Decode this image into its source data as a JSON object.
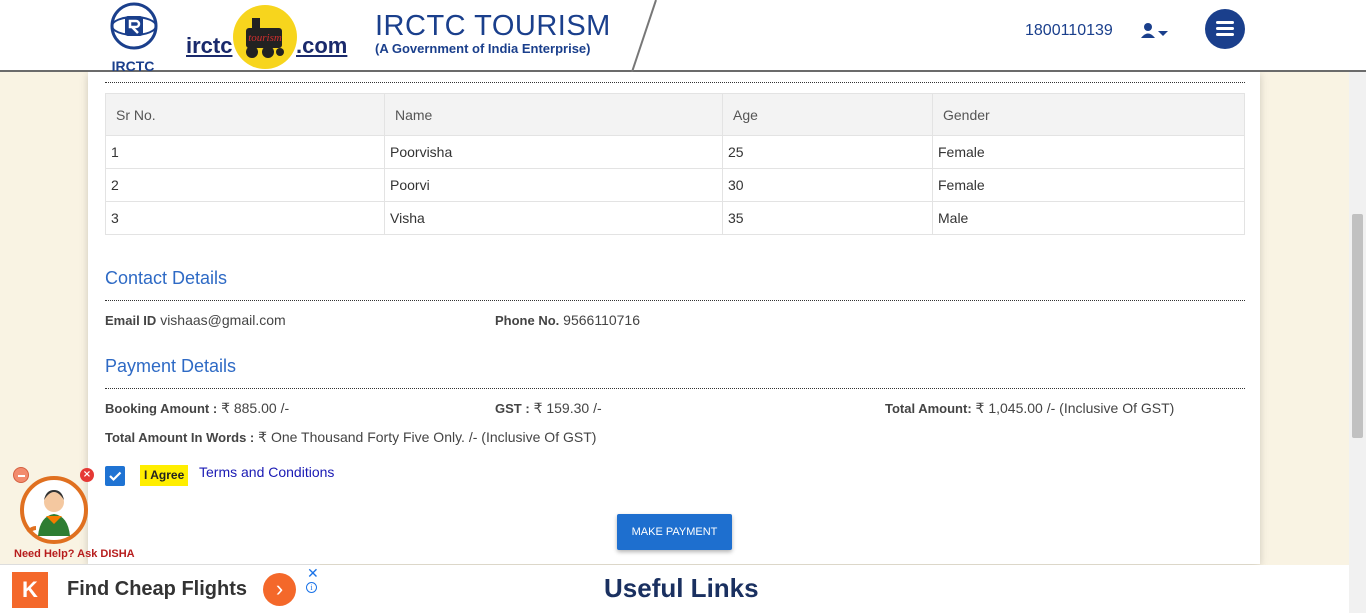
{
  "header": {
    "logo_caption": "IRCTC",
    "site_left": "irctc",
    "site_right": ".com",
    "brand_title": "IRCTC TOURISM",
    "brand_subtitle": "(A Government of India Enterprise)",
    "phone": "1800110139",
    "logo_badge_text": "tourism"
  },
  "passengers": {
    "headers": [
      "Sr No.",
      "Name",
      "Age",
      "Gender"
    ],
    "rows": [
      [
        "1",
        "Poorvisha",
        "25",
        "Female"
      ],
      [
        "2",
        "Poorvi",
        "30",
        "Female"
      ],
      [
        "3",
        "Visha",
        "35",
        "Male"
      ]
    ]
  },
  "contact": {
    "title": "Contact Details",
    "email_label": "Email ID",
    "email": "vishaas@gmail.com",
    "phone_label": "Phone No.",
    "phone": "9566110716"
  },
  "payment": {
    "title": "Payment Details",
    "booking_label": "Booking Amount :",
    "booking_value": "₹ 885.00 /-",
    "gst_label": "GST :",
    "gst_value": "₹ 159.30 /-",
    "total_label": "Total Amount:",
    "total_value": "₹ 1,045.00 /- (Inclusive Of GST)",
    "words_label": "Total Amount In Words :",
    "words_value": "₹ One Thousand Forty Five Only. /- (Inclusive Of GST)",
    "agree_label": "I Agree",
    "terms_label": "Terms and Conditions",
    "agree_checked": true,
    "make_payment_label": "MAKE PAYMENT"
  },
  "footer": {
    "useful_links": "Useful Links"
  },
  "ad": {
    "logo_letter": "K",
    "text": "Find Cheap Flights",
    "arrow": "›",
    "close": "✕",
    "info": "i"
  },
  "disha": {
    "label": "Need Help? Ask DISHA",
    "close": "×"
  },
  "colors": {
    "brand_blue": "#1a3f8c",
    "section_blue": "#2e6ac5",
    "button_blue": "#1e6fcf",
    "agree_yellow": "#ffee00",
    "ad_orange": "#f4682a",
    "page_bg": "#f9f3e3"
  }
}
